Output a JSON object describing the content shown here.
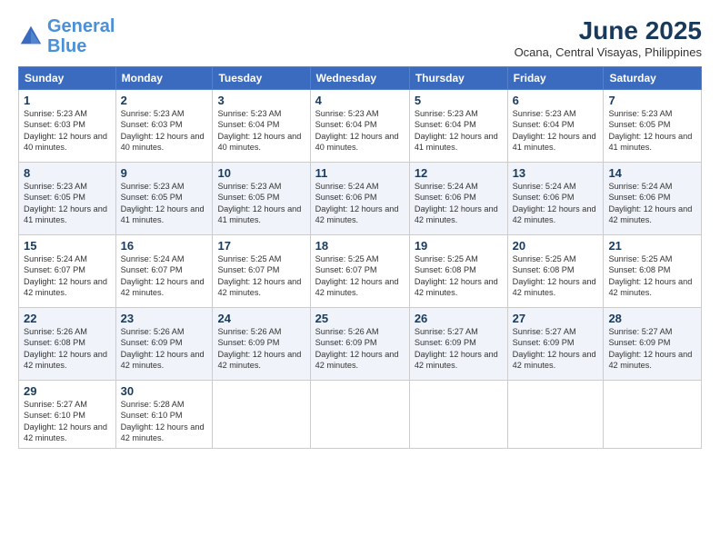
{
  "logo": {
    "line1": "General",
    "line2": "Blue"
  },
  "title": "June 2025",
  "location": "Ocana, Central Visayas, Philippines",
  "days_of_week": [
    "Sunday",
    "Monday",
    "Tuesday",
    "Wednesday",
    "Thursday",
    "Friday",
    "Saturday"
  ],
  "weeks": [
    [
      {
        "day": 1,
        "sunrise": "5:23 AM",
        "sunset": "6:03 PM",
        "daylight": "12 hours and 40 minutes."
      },
      {
        "day": 2,
        "sunrise": "5:23 AM",
        "sunset": "6:03 PM",
        "daylight": "12 hours and 40 minutes."
      },
      {
        "day": 3,
        "sunrise": "5:23 AM",
        "sunset": "6:04 PM",
        "daylight": "12 hours and 40 minutes."
      },
      {
        "day": 4,
        "sunrise": "5:23 AM",
        "sunset": "6:04 PM",
        "daylight": "12 hours and 40 minutes."
      },
      {
        "day": 5,
        "sunrise": "5:23 AM",
        "sunset": "6:04 PM",
        "daylight": "12 hours and 41 minutes."
      },
      {
        "day": 6,
        "sunrise": "5:23 AM",
        "sunset": "6:04 PM",
        "daylight": "12 hours and 41 minutes."
      },
      {
        "day": 7,
        "sunrise": "5:23 AM",
        "sunset": "6:05 PM",
        "daylight": "12 hours and 41 minutes."
      }
    ],
    [
      {
        "day": 8,
        "sunrise": "5:23 AM",
        "sunset": "6:05 PM",
        "daylight": "12 hours and 41 minutes."
      },
      {
        "day": 9,
        "sunrise": "5:23 AM",
        "sunset": "6:05 PM",
        "daylight": "12 hours and 41 minutes."
      },
      {
        "day": 10,
        "sunrise": "5:23 AM",
        "sunset": "6:05 PM",
        "daylight": "12 hours and 41 minutes."
      },
      {
        "day": 11,
        "sunrise": "5:24 AM",
        "sunset": "6:06 PM",
        "daylight": "12 hours and 42 minutes."
      },
      {
        "day": 12,
        "sunrise": "5:24 AM",
        "sunset": "6:06 PM",
        "daylight": "12 hours and 42 minutes."
      },
      {
        "day": 13,
        "sunrise": "5:24 AM",
        "sunset": "6:06 PM",
        "daylight": "12 hours and 42 minutes."
      },
      {
        "day": 14,
        "sunrise": "5:24 AM",
        "sunset": "6:06 PM",
        "daylight": "12 hours and 42 minutes."
      }
    ],
    [
      {
        "day": 15,
        "sunrise": "5:24 AM",
        "sunset": "6:07 PM",
        "daylight": "12 hours and 42 minutes."
      },
      {
        "day": 16,
        "sunrise": "5:24 AM",
        "sunset": "6:07 PM",
        "daylight": "12 hours and 42 minutes."
      },
      {
        "day": 17,
        "sunrise": "5:25 AM",
        "sunset": "6:07 PM",
        "daylight": "12 hours and 42 minutes."
      },
      {
        "day": 18,
        "sunrise": "5:25 AM",
        "sunset": "6:07 PM",
        "daylight": "12 hours and 42 minutes."
      },
      {
        "day": 19,
        "sunrise": "5:25 AM",
        "sunset": "6:08 PM",
        "daylight": "12 hours and 42 minutes."
      },
      {
        "day": 20,
        "sunrise": "5:25 AM",
        "sunset": "6:08 PM",
        "daylight": "12 hours and 42 minutes."
      },
      {
        "day": 21,
        "sunrise": "5:25 AM",
        "sunset": "6:08 PM",
        "daylight": "12 hours and 42 minutes."
      }
    ],
    [
      {
        "day": 22,
        "sunrise": "5:26 AM",
        "sunset": "6:08 PM",
        "daylight": "12 hours and 42 minutes."
      },
      {
        "day": 23,
        "sunrise": "5:26 AM",
        "sunset": "6:09 PM",
        "daylight": "12 hours and 42 minutes."
      },
      {
        "day": 24,
        "sunrise": "5:26 AM",
        "sunset": "6:09 PM",
        "daylight": "12 hours and 42 minutes."
      },
      {
        "day": 25,
        "sunrise": "5:26 AM",
        "sunset": "6:09 PM",
        "daylight": "12 hours and 42 minutes."
      },
      {
        "day": 26,
        "sunrise": "5:27 AM",
        "sunset": "6:09 PM",
        "daylight": "12 hours and 42 minutes."
      },
      {
        "day": 27,
        "sunrise": "5:27 AM",
        "sunset": "6:09 PM",
        "daylight": "12 hours and 42 minutes."
      },
      {
        "day": 28,
        "sunrise": "5:27 AM",
        "sunset": "6:09 PM",
        "daylight": "12 hours and 42 minutes."
      }
    ],
    [
      {
        "day": 29,
        "sunrise": "5:27 AM",
        "sunset": "6:10 PM",
        "daylight": "12 hours and 42 minutes."
      },
      {
        "day": 30,
        "sunrise": "5:28 AM",
        "sunset": "6:10 PM",
        "daylight": "12 hours and 42 minutes."
      },
      null,
      null,
      null,
      null,
      null
    ]
  ]
}
